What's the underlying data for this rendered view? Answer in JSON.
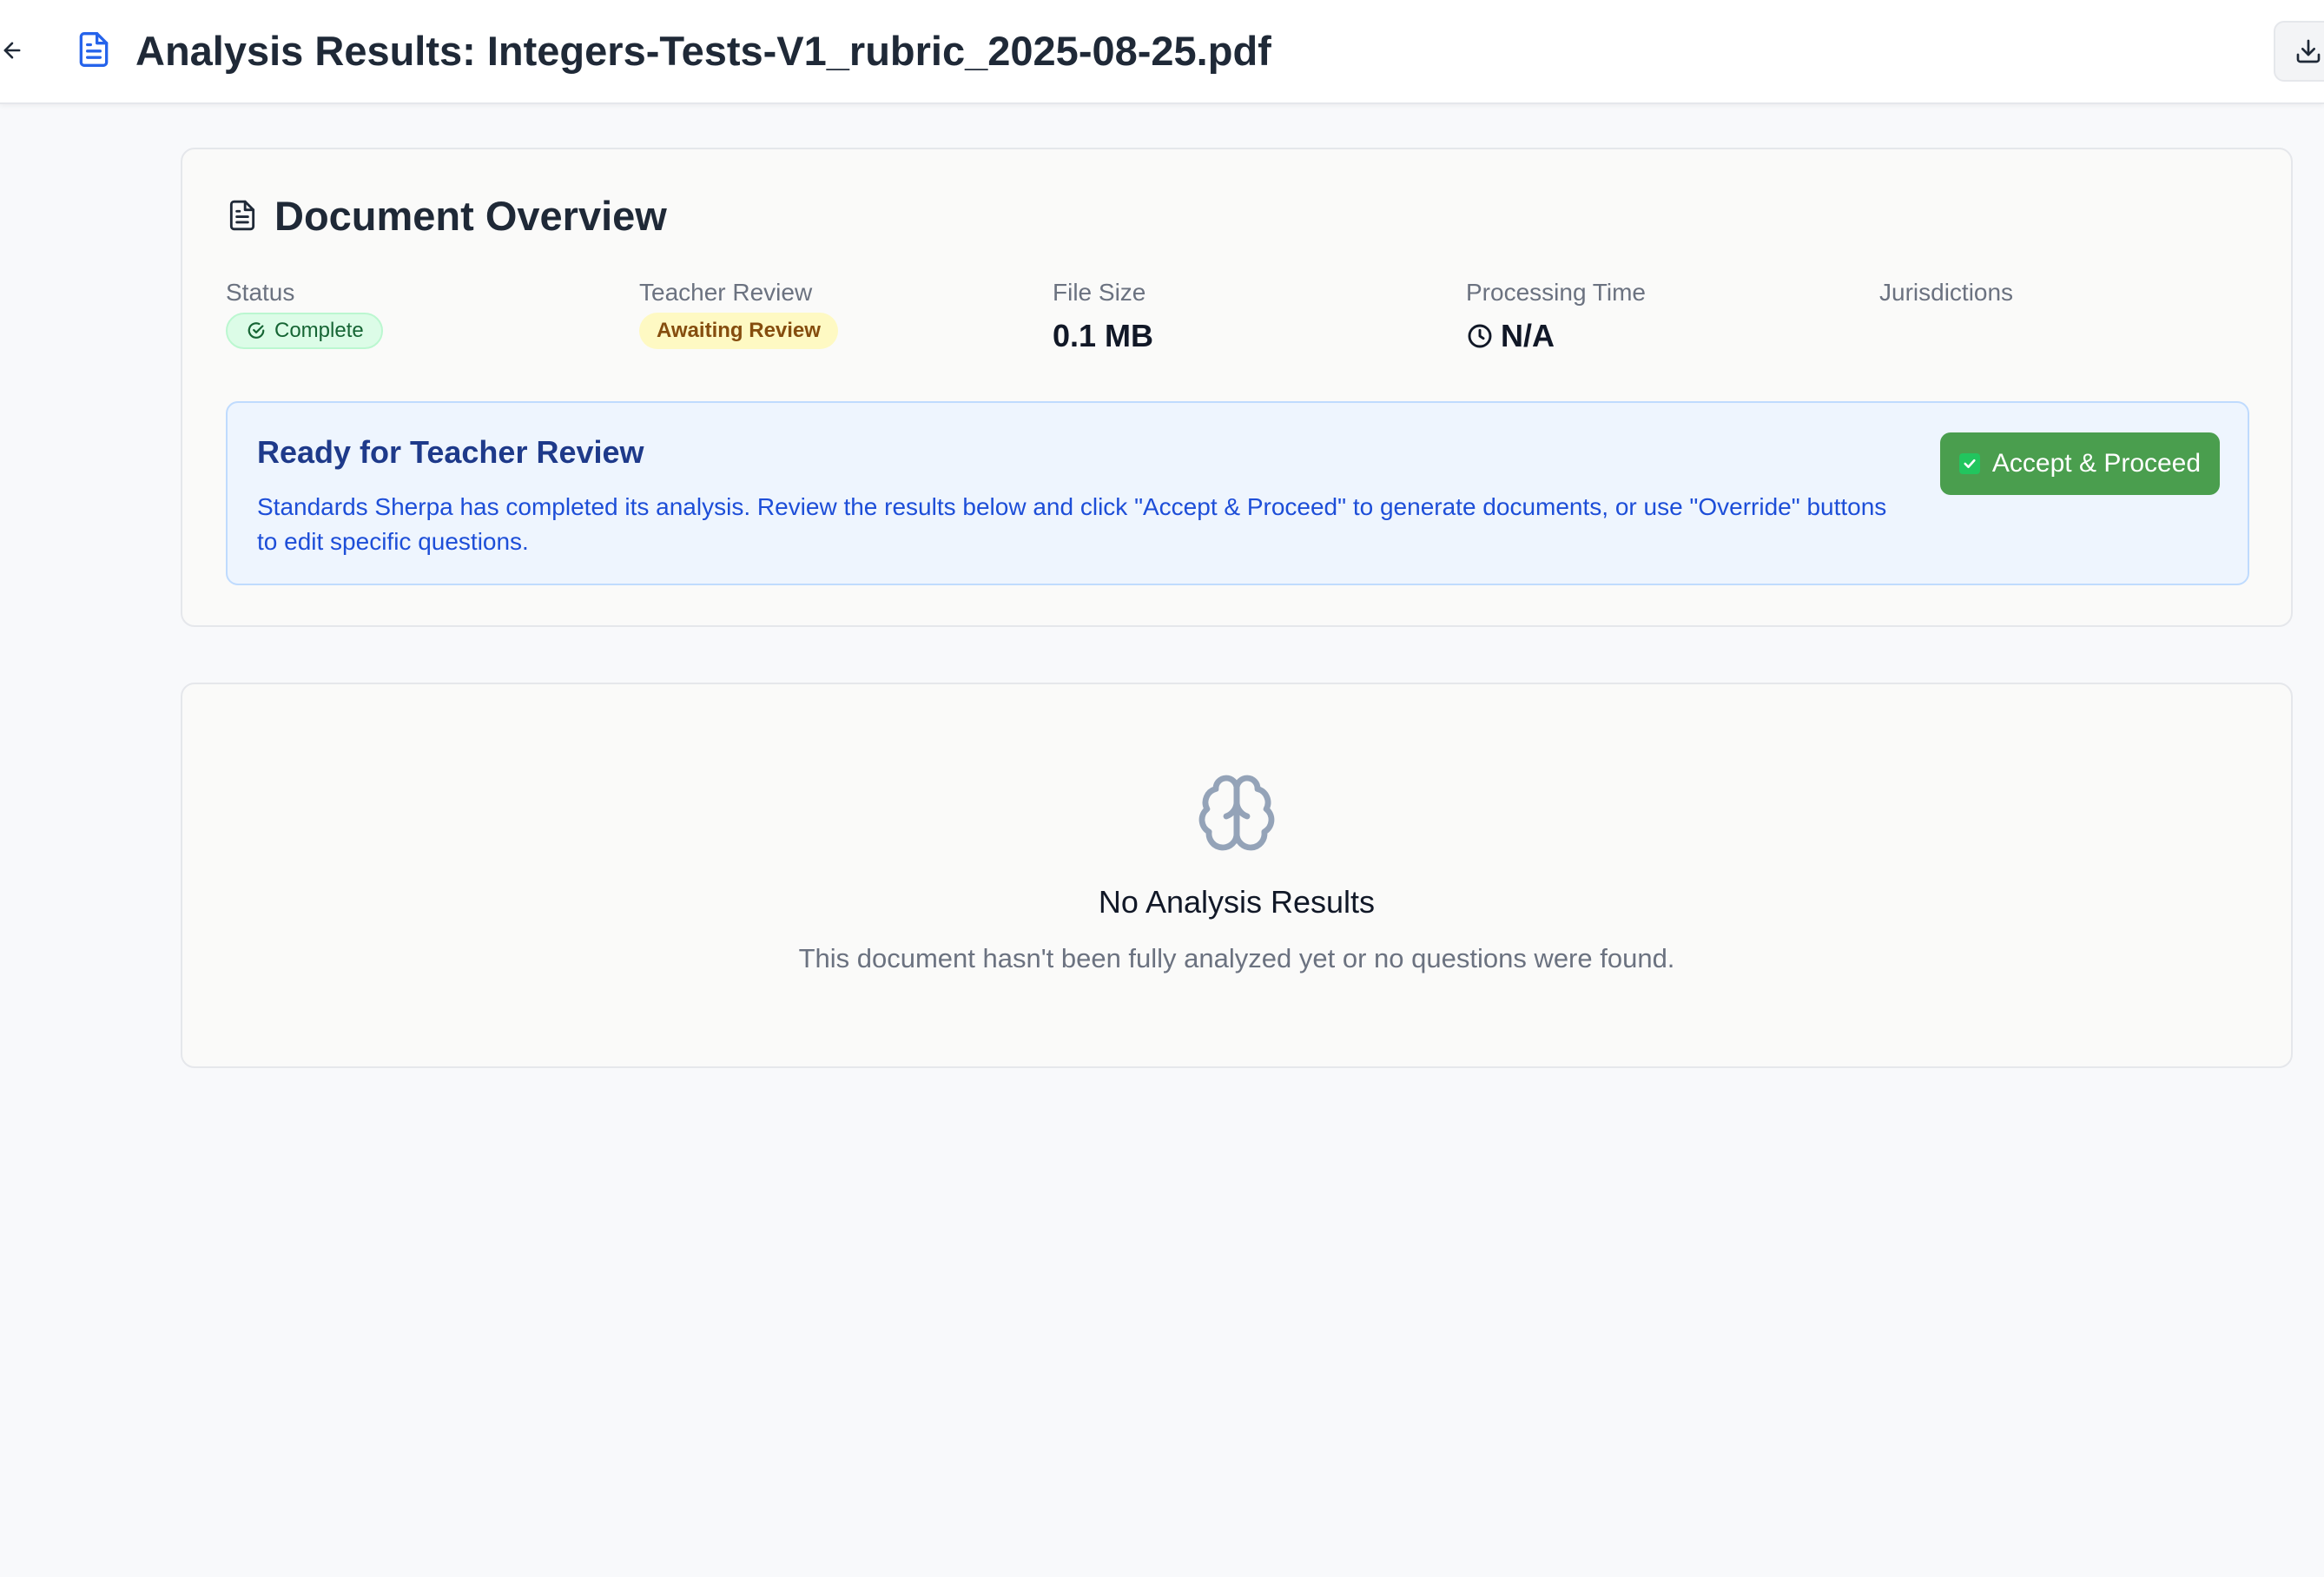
{
  "header": {
    "title": "Analysis Results: Integers-Tests-V1_rubric_2025-08-25.pdf",
    "back_icon": "arrow-left-icon",
    "doc_icon": "file-text-icon",
    "download_icon": "download-icon"
  },
  "overview": {
    "title": "Document Overview",
    "icon": "file-text-icon",
    "stats": {
      "status": {
        "label": "Status",
        "value": "Complete"
      },
      "teacher_review": {
        "label": "Teacher Review",
        "value": "Awaiting Review"
      },
      "file_size": {
        "label": "File Size",
        "value": "0.1 MB"
      },
      "processing_time": {
        "label": "Processing Time",
        "value": "N/A"
      },
      "jurisdictions": {
        "label": "Jurisdictions",
        "value": ""
      }
    },
    "review_box": {
      "title": "Ready for Teacher Review",
      "text": "Standards Sherpa has completed its analysis. Review the results below and click \"Accept & Proceed\" to generate documents, or use \"Override\" buttons to edit specific questions.",
      "accept_label": "Accept & Proceed"
    }
  },
  "empty_state": {
    "icon": "brain-icon",
    "title": "No Analysis Results",
    "text": "This document hasn't been fully analyzed yet or no questions were found."
  },
  "colors": {
    "accent_blue": "#2563eb",
    "success_green": "#4a9e4e",
    "warning_yellow": "#fef9c3"
  }
}
